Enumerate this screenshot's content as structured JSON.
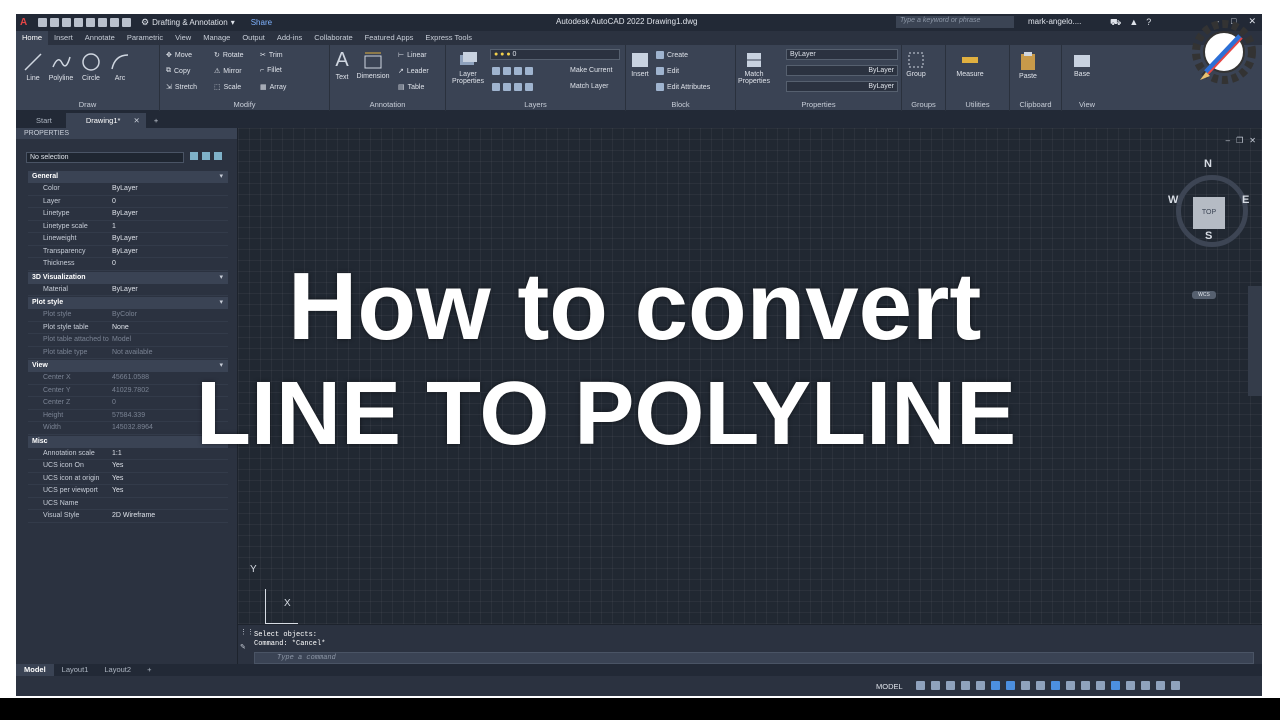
{
  "title_bar": {
    "workspace": "Drafting & Annotation",
    "share": "Share",
    "app_title": "Autodesk AutoCAD 2022   Drawing1.dwg",
    "search_placeholder": "Type a keyword or phrase",
    "user": "mark-angelo...."
  },
  "ribbon_tabs": [
    "Home",
    "Insert",
    "Annotate",
    "Parametric",
    "View",
    "Manage",
    "Output",
    "Add-ins",
    "Collaborate",
    "Featured Apps",
    "Express Tools"
  ],
  "ribbon": {
    "draw": {
      "line": "Line",
      "polyline": "Polyline",
      "circle": "Circle",
      "arc": "Arc",
      "label": "Draw"
    },
    "modify": {
      "move": "Move",
      "rotate": "Rotate",
      "trim": "Trim",
      "copy": "Copy",
      "mirror": "Mirror",
      "fillet": "Fillet",
      "stretch": "Stretch",
      "scale": "Scale",
      "array": "Array",
      "label": "Modify"
    },
    "annotation": {
      "text": "Text",
      "dimension": "Dimension",
      "linear": "Linear",
      "leader": "Leader",
      "table": "Table",
      "label": "Annotation"
    },
    "layers": {
      "layer_properties": "Layer Properties",
      "layer_value": "0",
      "make_current": "Make Current",
      "match_layer": "Match Layer",
      "label": "Layers"
    },
    "block": {
      "insert": "Insert",
      "create": "Create",
      "edit": "Edit",
      "edit_attributes": "Edit Attributes",
      "label": "Block"
    },
    "properties": {
      "match_properties": "Match Properties",
      "bylayer_1": "ByLayer",
      "bylayer_2": "ByLayer",
      "bylayer_3": "ByLayer",
      "label": "Properties"
    },
    "groups": {
      "group": "Group",
      "label": "Groups"
    },
    "utilities": {
      "measure": "Measure",
      "label": "Utilities"
    },
    "clipboard": {
      "paste": "Paste",
      "label": "Clipboard"
    },
    "view": {
      "base": "Base",
      "label": "View"
    }
  },
  "file_tabs": {
    "start": "Start",
    "drawing": "Drawing1*"
  },
  "properties_palette": {
    "header": "PROPERTIES",
    "selection": "No selection",
    "sections": [
      {
        "title": "General",
        "rows": [
          {
            "k": "Color",
            "v": "ByLayer"
          },
          {
            "k": "Layer",
            "v": "0"
          },
          {
            "k": "Linetype",
            "v": "ByLayer"
          },
          {
            "k": "Linetype scale",
            "v": "1"
          },
          {
            "k": "Lineweight",
            "v": "ByLayer"
          },
          {
            "k": "Transparency",
            "v": "ByLayer"
          },
          {
            "k": "Thickness",
            "v": "0"
          }
        ]
      },
      {
        "title": "3D Visualization",
        "rows": [
          {
            "k": "Material",
            "v": "ByLayer"
          }
        ]
      },
      {
        "title": "Plot style",
        "rows": [
          {
            "k": "Plot style",
            "v": "ByColor",
            "dim": true
          },
          {
            "k": "Plot style table",
            "v": "None"
          },
          {
            "k": "Plot table attached to",
            "v": "Model",
            "dim": true
          },
          {
            "k": "Plot table type",
            "v": "Not available",
            "dim": true
          }
        ]
      },
      {
        "title": "View",
        "rows": [
          {
            "k": "Center X",
            "v": "45661.0588",
            "dim": true
          },
          {
            "k": "Center Y",
            "v": "41029.7802",
            "dim": true
          },
          {
            "k": "Center Z",
            "v": "0",
            "dim": true
          },
          {
            "k": "Height",
            "v": "57584.339",
            "dim": true
          },
          {
            "k": "Width",
            "v": "145032.8964",
            "dim": true
          }
        ]
      },
      {
        "title": "Misc",
        "rows": [
          {
            "k": "Annotation scale",
            "v": "1:1"
          },
          {
            "k": "UCS icon On",
            "v": "Yes"
          },
          {
            "k": "UCS icon at origin",
            "v": "Yes"
          },
          {
            "k": "UCS per viewport",
            "v": "Yes"
          },
          {
            "k": "UCS Name",
            "v": ""
          },
          {
            "k": "Visual Style",
            "v": "2D Wireframe"
          }
        ]
      }
    ]
  },
  "viewcube": {
    "n": "N",
    "s": "S",
    "e": "E",
    "w": "W",
    "face": "TOP",
    "wcs": "WCS"
  },
  "overlay": {
    "line1": "How to convert",
    "line2": "LINE TO POLYLINE"
  },
  "ucs": {
    "x": "X",
    "y": "Y"
  },
  "command_line": {
    "history_1": "Select objects:",
    "history_2": "Command: *Cancel*",
    "placeholder": "Type a command"
  },
  "layout_tabs": [
    "Model",
    "Layout1",
    "Layout2"
  ],
  "status_bar": {
    "model": "MODEL"
  }
}
